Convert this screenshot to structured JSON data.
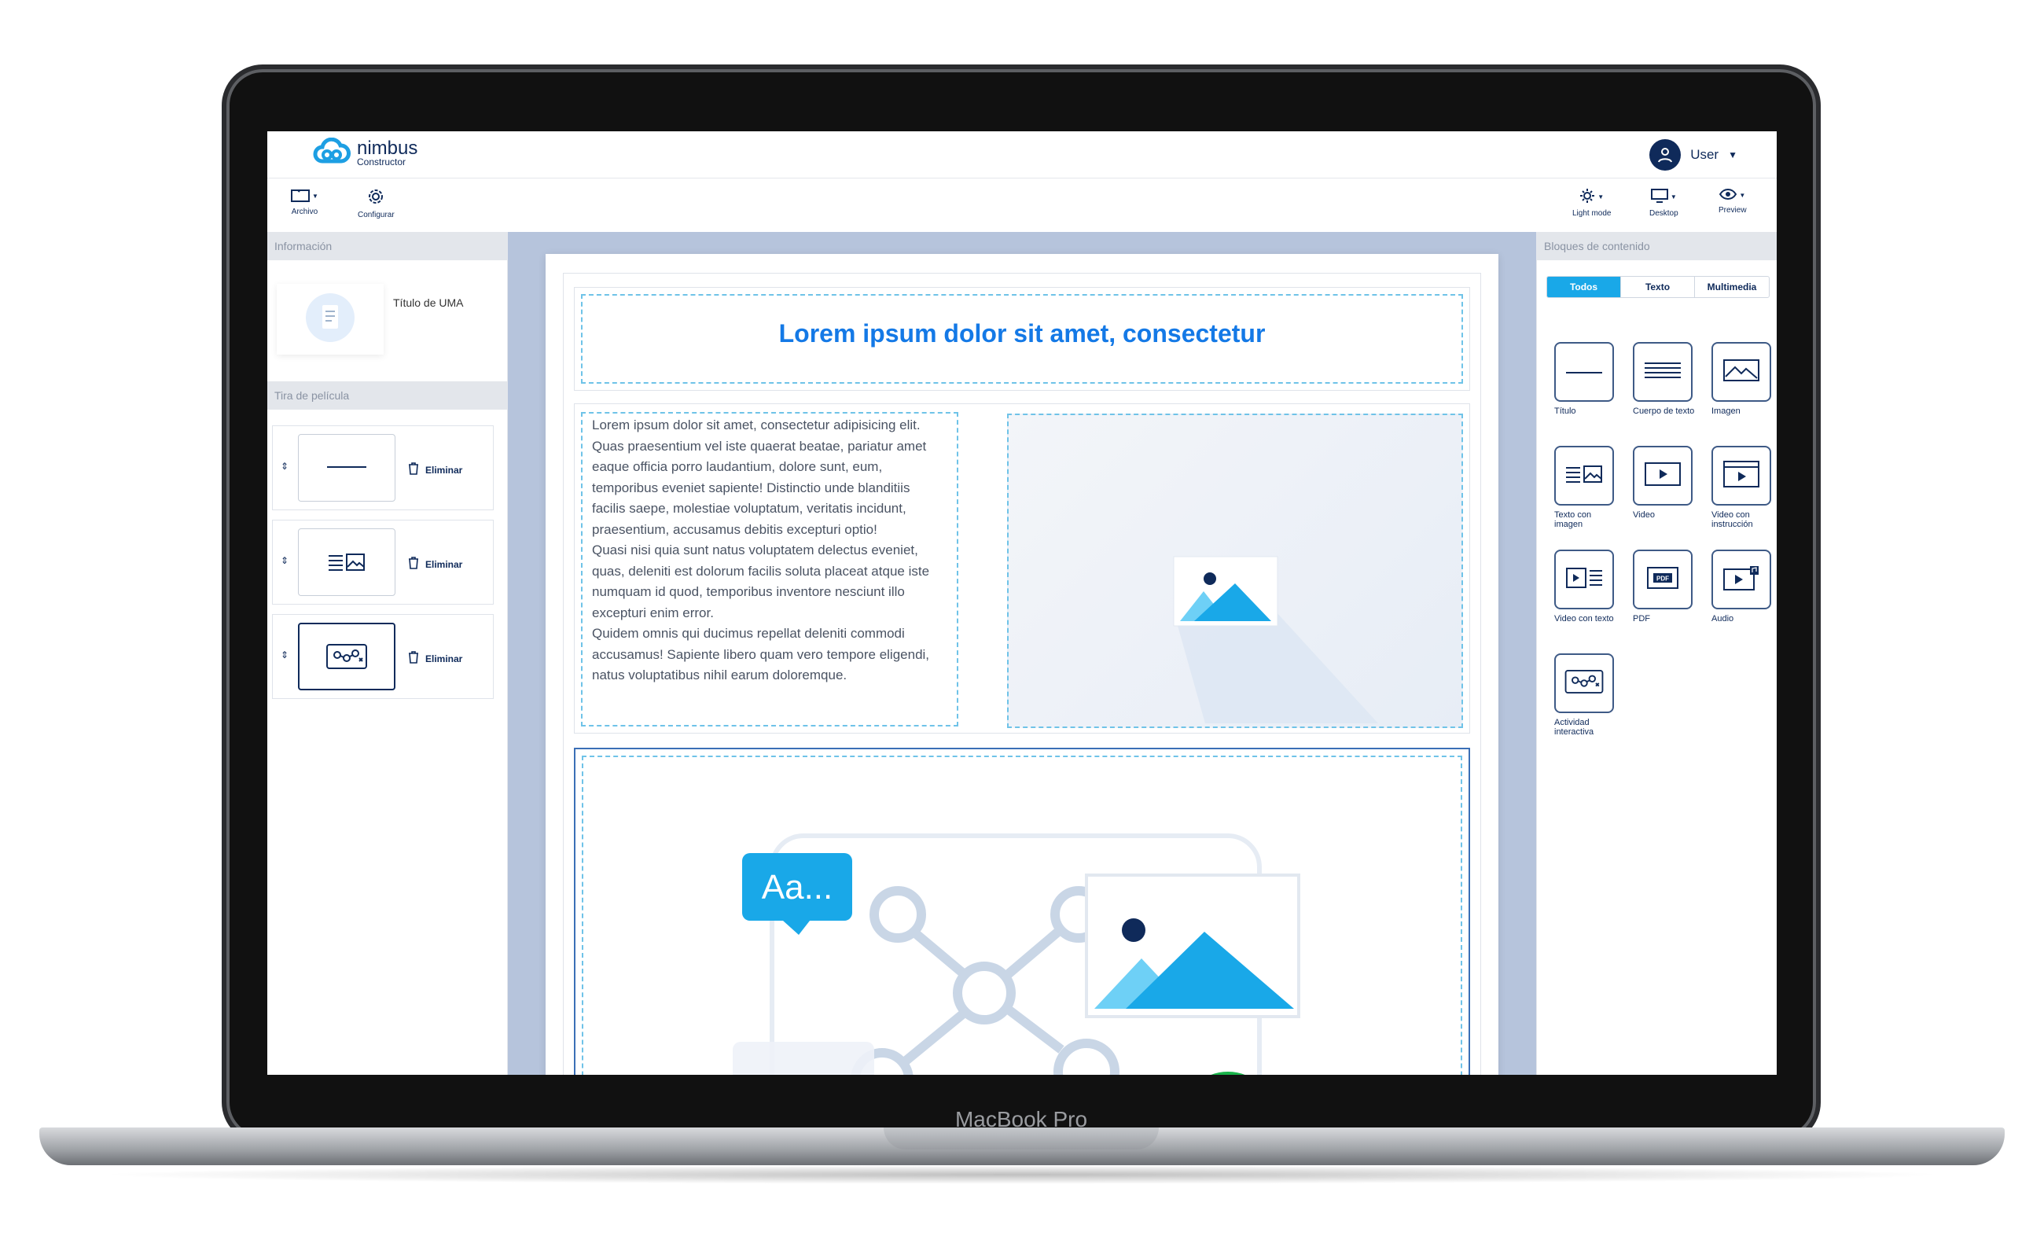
{
  "device": {
    "brand": "MacBook Pro"
  },
  "app": {
    "name": "nimbus",
    "subtitle": "Constructor"
  },
  "user": {
    "name": "User"
  },
  "toolbar": {
    "archivo": "Archivo",
    "configurar": "Configurar",
    "light_mode": "Light mode",
    "desktop": "Desktop",
    "preview": "Preview"
  },
  "left_panel": {
    "info_header": "Información",
    "info_title": "Título de UMA",
    "film_header": "Tira de película",
    "film_items": [
      {
        "icon": "title-line-icon",
        "delete_label": "Eliminar"
      },
      {
        "icon": "text-with-image-icon",
        "delete_label": "Eliminar"
      },
      {
        "icon": "interactive-activity-icon",
        "delete_label": "Eliminar"
      }
    ]
  },
  "canvas": {
    "title": "Lorem ipsum dolor sit amet, consectetur",
    "paragraph": "Lorem ipsum dolor sit amet, consectetur adipisicing elit. Quas praesentium vel iste quaerat beatae, pariatur amet eaque officia porro laudantium, dolore sunt, eum, temporibus eveniet sapiente! Distinctio unde blanditiis facilis saepe, molestiae voluptatum, veritatis incidunt, praesentium, accusamus debitis excepturi optio!\nQuasi nisi quia sunt natus voluptatem delectus eveniet, quas, deleniti est dolorum facilis soluta placeat atque iste numquam id quod, temporibus inventore nesciunt illo excepturi enim error.\nQuidem omnis qui ducimus repellat deleniti commodi accusamus! Sapiente libero quam vero tempore eligendi, natus voluptatibus nihil earum doloremque.",
    "interactive_bubble": "Aa..."
  },
  "right_panel": {
    "header": "Bloques de contenido",
    "tabs": [
      "Todos",
      "Texto",
      "Multimedia"
    ],
    "active_tab": "Todos",
    "blocks": [
      "Título",
      "Cuerpo de texto",
      "Imagen",
      "Texto con imagen",
      "Video",
      "Video con instrucción",
      "Video con texto",
      "PDF",
      "Audio",
      "Actividad interactiva"
    ]
  },
  "colors": {
    "accent": "#19a8e8",
    "title_blue": "#1479e6",
    "navy": "#0f2a5a",
    "canvas_bg": "#b6c4dc"
  }
}
